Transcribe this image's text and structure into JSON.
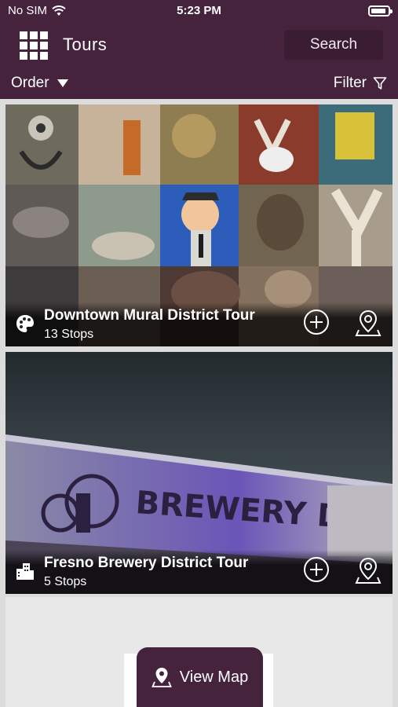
{
  "status_bar": {
    "carrier": "No SIM",
    "time": "5:23 PM"
  },
  "header": {
    "title": "Tours",
    "search_label": "Search"
  },
  "toolbar": {
    "order_label": "Order",
    "filter_label": "Filter"
  },
  "tours": [
    {
      "title": "Downtown Mural District Tour",
      "stops": "13 Stops",
      "category_icon": "palette-icon"
    },
    {
      "title": "Fresno Brewery District Tour",
      "stops": "5 Stops",
      "category_icon": "buildings-icon"
    }
  ],
  "footer": {
    "view_map_label": "View Map"
  },
  "colors": {
    "brand": "#45233d",
    "brand_dark": "#3a1c33",
    "background": "#dcdcdc"
  }
}
